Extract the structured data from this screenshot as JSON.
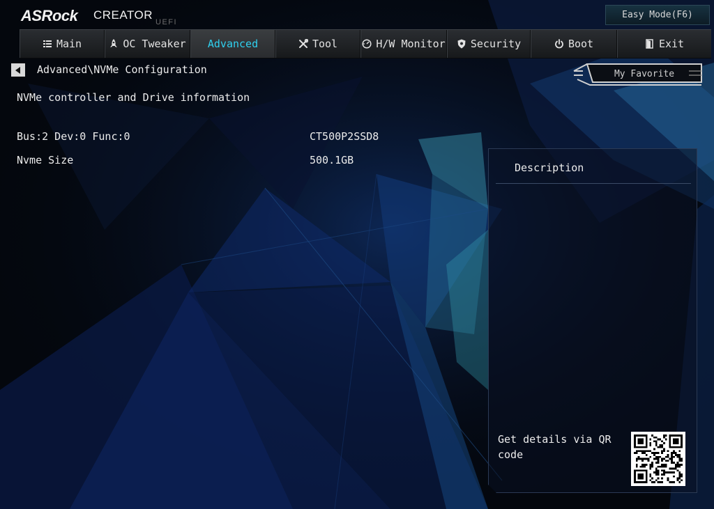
{
  "brand": {
    "logo": "ASRock",
    "product": "CREATOR",
    "sub": "UEFI"
  },
  "easy_mode": {
    "label": "Easy Mode(F6)"
  },
  "tabs": [
    {
      "label": "Main",
      "icon": "list-icon",
      "active": false
    },
    {
      "label": "OC Tweaker",
      "icon": "rocket-icon",
      "active": false
    },
    {
      "label": "Advanced",
      "icon": "",
      "active": true
    },
    {
      "label": "Tool",
      "icon": "tools-icon",
      "active": false
    },
    {
      "label": "H/W Monitor",
      "icon": "monitor-dial-icon",
      "active": false
    },
    {
      "label": "Security",
      "icon": "shield-icon",
      "active": false
    },
    {
      "label": "Boot",
      "icon": "power-icon",
      "active": false
    },
    {
      "label": "Exit",
      "icon": "exit-door-icon",
      "active": false
    }
  ],
  "breadcrumb": {
    "path": "Advanced\\NVMe Configuration",
    "back_icon": "triangle-left-icon"
  },
  "favorite": {
    "label": "My Favorite"
  },
  "content": {
    "heading": "NVMe controller and Drive information",
    "rows": [
      {
        "label": "Bus:2 Dev:0 Func:0",
        "value": "CT500P2SSD8"
      },
      {
        "label": "Nvme Size",
        "value": "500.1GB"
      }
    ]
  },
  "description": {
    "title": "Description",
    "qr_text": "Get details via QR code",
    "qr_icon": "qr-code-icon"
  },
  "colors": {
    "accent": "#2fd0ef",
    "background": "#05080f",
    "text": "#ececec"
  }
}
